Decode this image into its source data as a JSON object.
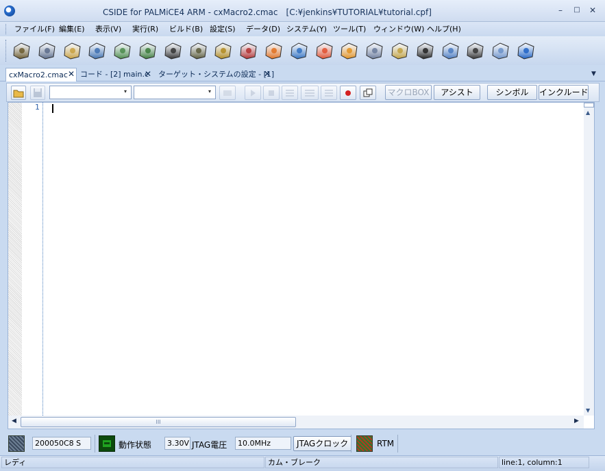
{
  "window": {
    "title": "CSIDE for PALMiCE4 ARM - cxMacro2.cmac　[C:¥jenkins¥TUTORIAL¥tutorial.cpf]",
    "min_glyph": "–",
    "max_glyph": "□",
    "close_glyph": "✕"
  },
  "menu": {
    "items": [
      {
        "label": "ファイル(F)"
      },
      {
        "label": "編集(E)"
      },
      {
        "label": "表示(V)"
      },
      {
        "label": "実行(R)"
      },
      {
        "label": "ビルド(B)"
      },
      {
        "label": "設定(S)"
      },
      {
        "label": "データ(D)"
      },
      {
        "label": "システム(Y)"
      },
      {
        "label": "ツール(T)"
      },
      {
        "label": "ウィンドウ(W)"
      },
      {
        "label": "ヘルプ(H)"
      }
    ]
  },
  "toolbar": {
    "icons": [
      {
        "name": "open-project-icon",
        "color": "#6b5a2e"
      },
      {
        "name": "open-folder-icon",
        "color": "#5a6b8a"
      },
      {
        "name": "folder-icon",
        "color": "#c8a040"
      },
      {
        "name": "books-icon",
        "color": "#3d6fb0"
      },
      {
        "name": "document-list-icon",
        "color": "#4a8a4a"
      },
      {
        "name": "source-file-icon",
        "color": "#3a7a3a"
      },
      {
        "name": "floppy-disk-icon",
        "color": "#333333"
      },
      {
        "name": "search-magnifier-icon",
        "color": "#5a5a3a"
      },
      {
        "name": "build-icon",
        "color": "#b08a20"
      },
      {
        "name": "rebuild-icon",
        "color": "#b03030"
      },
      {
        "name": "download-icon",
        "color": "#e07020"
      },
      {
        "name": "reset-icon",
        "color": "#3070c0"
      },
      {
        "name": "go-icon",
        "color": "#e05030"
      },
      {
        "name": "step-icon",
        "color": "#e09020"
      },
      {
        "name": "step-over-icon",
        "color": "#6a7a9a"
      },
      {
        "name": "step-out-icon",
        "color": "#c0a040"
      },
      {
        "name": "stop-icon",
        "color": "#222222"
      },
      {
        "name": "memory-chip-icon",
        "color": "#4a7ac0"
      },
      {
        "name": "trace-icon",
        "color": "#333333"
      },
      {
        "name": "cloud-icon",
        "color": "#6a90c8"
      },
      {
        "name": "help-globe-icon",
        "color": "#1f63c6"
      }
    ]
  },
  "tabs": [
    {
      "label": "cxMacro2.cmac",
      "active": true
    },
    {
      "label": "コード - [2] main.c",
      "active": false
    },
    {
      "label": "ターゲット・システムの設定 - [1]",
      "active": false
    }
  ],
  "tab_close_glyph": "✕",
  "tab_menu_glyph": "▼",
  "edit_toolbar": {
    "combo1_value": "",
    "combo2_value": "",
    "combo_arrow": "▾",
    "macro_box_label": "マクロBOX",
    "assist_label": "アシスト",
    "symbol_label": "シンボル",
    "include_label": "インクルード"
  },
  "editor": {
    "line_number": "1",
    "content": ""
  },
  "scroll": {
    "up_glyph": "▲",
    "down_glyph": "▼",
    "left_glyph": "◀",
    "right_glyph": "▶",
    "thumb_grip": "III"
  },
  "status_panel": {
    "address": "200050C8 S",
    "run_state_label": "動作状態",
    "voltage_value": "3.30V",
    "voltage_label": "JTAG電圧",
    "clock_value": "10.0MHz",
    "clock_button": "JTAGクロック",
    "rtm_label": "RTM"
  },
  "statusbar": {
    "ready": "レディ",
    "cam_break": "カム・ブレーク",
    "position": "line:1, column:1"
  }
}
